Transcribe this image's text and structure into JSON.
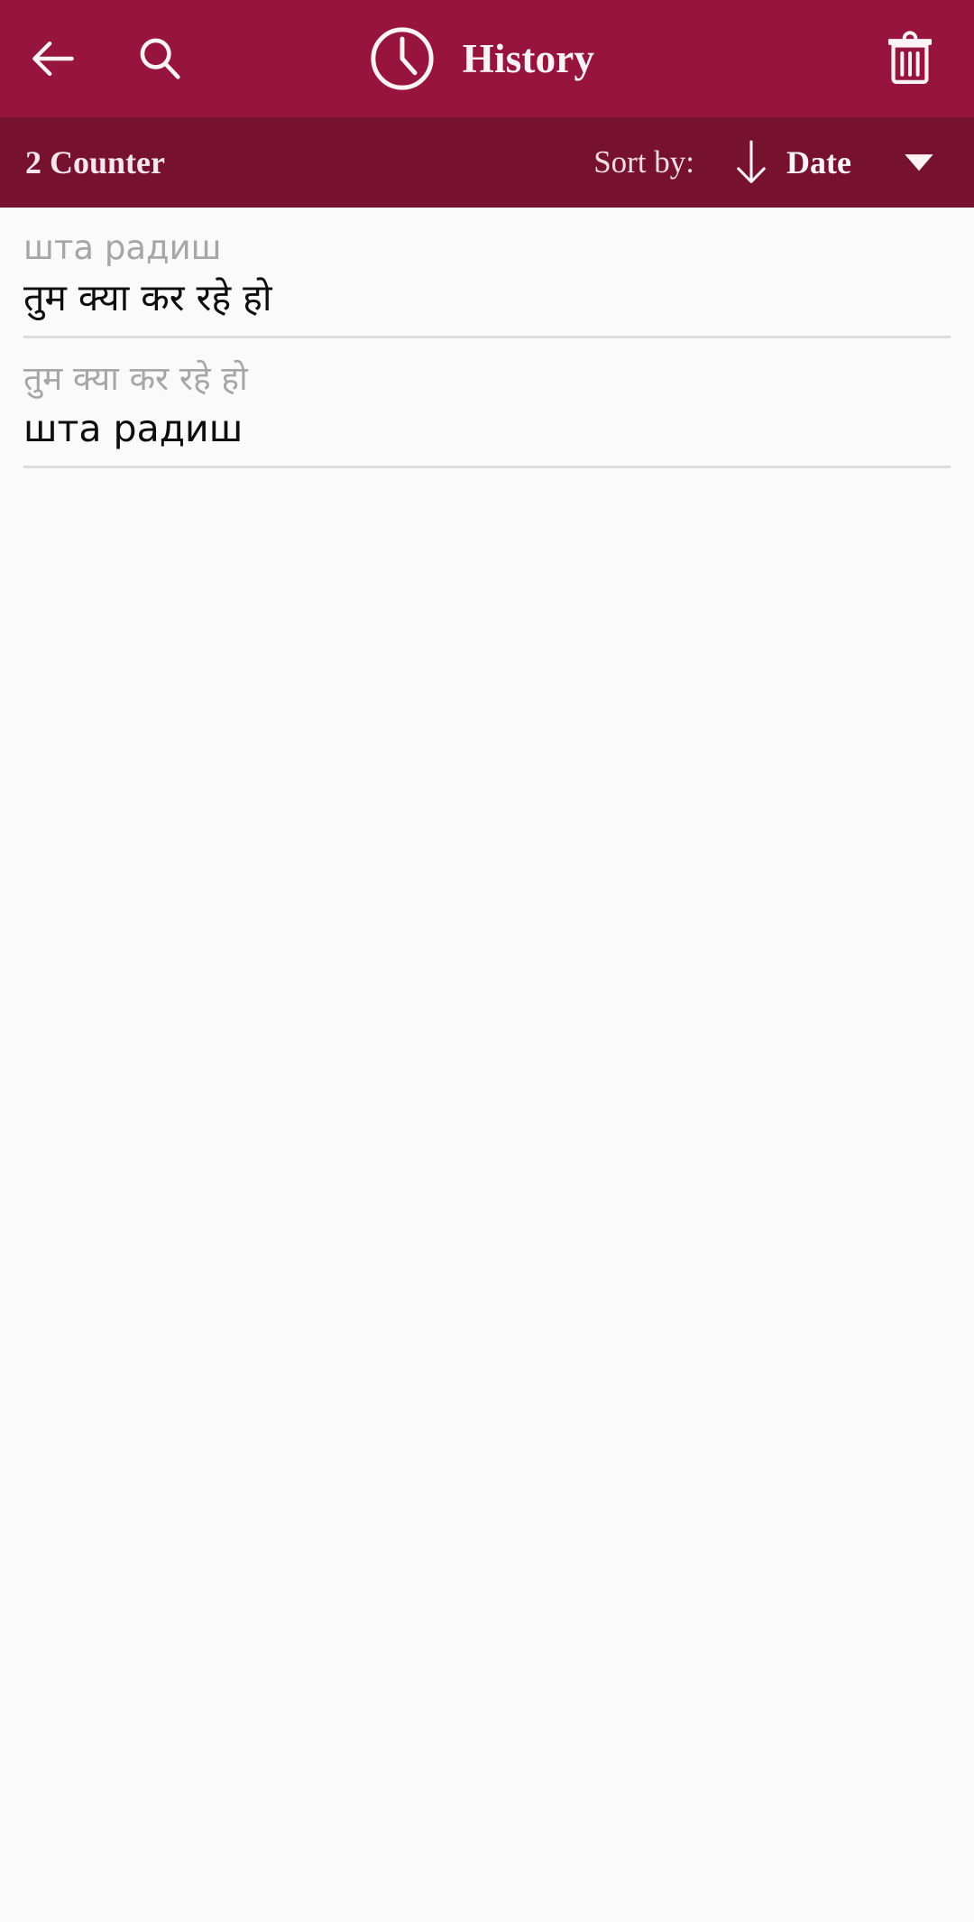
{
  "appbar": {
    "back_icon": "arrow-left-icon",
    "search_icon": "search-icon",
    "clock_icon": "clock-icon",
    "title": "History",
    "delete_icon": "trash-icon",
    "background_color": "#97143f",
    "text_color": "#fdf3f6"
  },
  "sortbar": {
    "counter": "2 Counter",
    "sort_by_label": "Sort by:",
    "sort_direction_icon": "arrow-down-icon",
    "sort_field": "Date",
    "dropdown_icon": "caret-down-icon",
    "background_color": "#771130"
  },
  "history": {
    "rows": [
      {
        "source": "шта радиш",
        "target": "तुम क्या कर रहे हो"
      },
      {
        "source": "तुम क्या कर रहे हो",
        "target": "шта радиш"
      }
    ]
  },
  "colors": {
    "page_background": "#fafafa",
    "source_text": "#a6a6a6",
    "target_text": "#0d0d0d",
    "divider": "#dcdcdc"
  }
}
